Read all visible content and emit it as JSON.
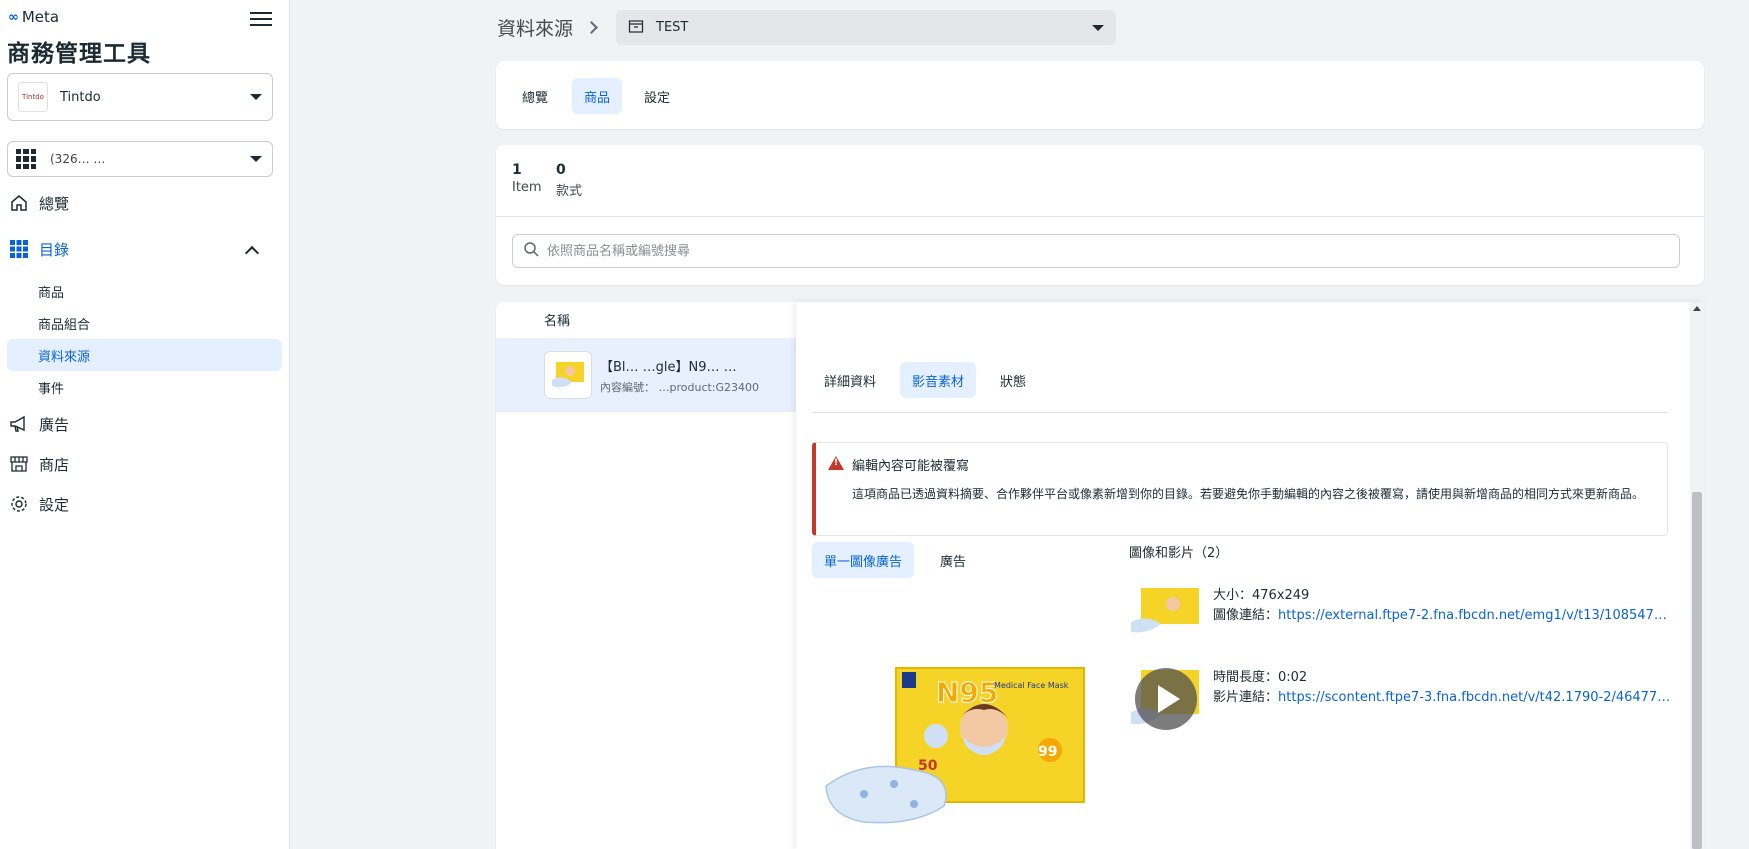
{
  "brand": "Meta",
  "app_title": "商務管理工具",
  "business": {
    "name": "Tintdo",
    "avatar_text": "Tintdo"
  },
  "account": {
    "name": "(326… …"
  },
  "nav": {
    "overview": "總覽",
    "catalog": "目錄",
    "catalog_items": [
      "商品",
      "商品組合",
      "資料來源",
      "事件"
    ],
    "ads": "廣告",
    "shop": "商店",
    "settings": "設定"
  },
  "breadcrumb": {
    "title": "資料來源",
    "source": "TEST"
  },
  "tabs": [
    "總覽",
    "商品",
    "設定"
  ],
  "stats": [
    {
      "num": "1",
      "label": "Item"
    },
    {
      "num": "0",
      "label": "款式"
    }
  ],
  "search": {
    "placeholder": "依照商品名稱或編號搜尋"
  },
  "list": {
    "header": "名稱",
    "row_title": "【Bl… …gle】N9… …",
    "row_sub": "內容編號： …product:G23400"
  },
  "panel": {
    "tabs": [
      "詳細資料",
      "影音素材",
      "狀態"
    ],
    "warning_title": "編輯內容可能被覆寫",
    "warning_body": "這項商品已透過資料摘要、合作夥伴平台或像素新增到你的目錄。若要避免你手動編輯的內容之後被覆寫，請使用與新增商品的相同方式來更新商品。",
    "sub_tabs": [
      "單一圖像廣告",
      "廣告"
    ],
    "media_heading": "圖像和影片（2）",
    "media": [
      {
        "line1": "大小：476x249",
        "line2_label": "圖像連結：",
        "link": "https://external.ftpe7-2.fna.fbcdn.net/emg1/v/t13/1085470..."
      },
      {
        "line1": "時間長度：0:02",
        "line2_label": "影片連結：",
        "link": "https://scontent.ftpe7-3.fna.fbcdn.net/v/t42.1790-2/464770..."
      }
    ],
    "preview_text": {
      "n95": "N95",
      "mask": "Medical Face Mask",
      "count": "50",
      "badge": "99"
    }
  },
  "colors": {
    "accent": "#0a63d6",
    "active_bg": "#e4efff",
    "warning": "#c0392b",
    "product_yellow": "#f5d327"
  }
}
